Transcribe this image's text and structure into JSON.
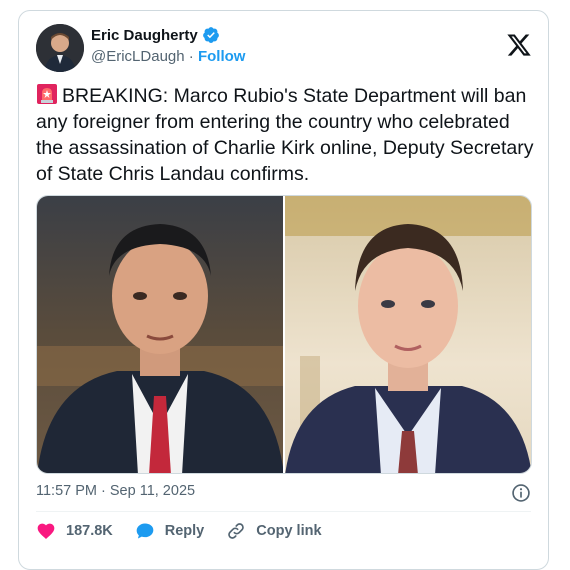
{
  "author": {
    "name": "Eric Daugherty",
    "handle": "@EricLDaugh",
    "separator": " · ",
    "follow_label": "Follow"
  },
  "tweet": {
    "text": "BREAKING: Marco Rubio's State Department will ban any foreigner from entering the country who celebrated the assassination of Charlie Kirk online, Deputy Secretary of State Chris Landau confirms.",
    "emoji_icon": "police-siren-icon"
  },
  "media": {
    "count": 2
  },
  "timestamp": "11:57 PM · Sep 11, 2025",
  "actions": {
    "likes_count": "187.8K",
    "reply_label": "Reply",
    "copy_link_label": "Copy link"
  },
  "colors": {
    "accent": "#1d9bf0",
    "heart": "#f91880",
    "text": "#0f1419",
    "secondary": "#536471"
  }
}
